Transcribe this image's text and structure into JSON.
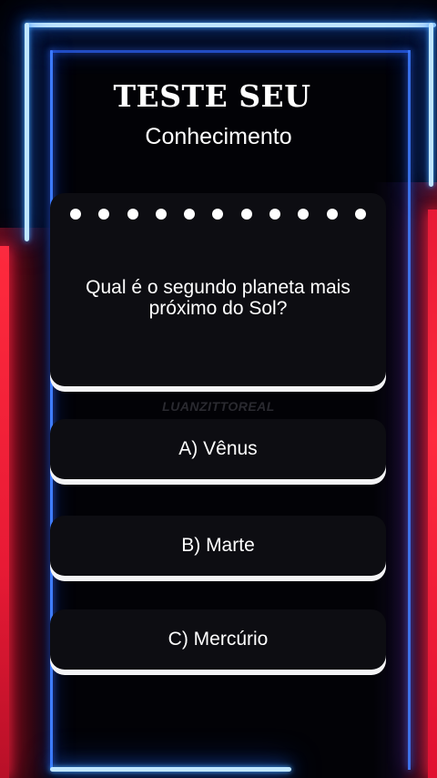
{
  "header": {
    "title": "TESTE SEU",
    "subtitle": "Conhecimento"
  },
  "question": {
    "progress_total": 11,
    "text": "Qual é o segundo planeta mais próximo do Sol?"
  },
  "watermark": "LUANZITTOREAL",
  "options": [
    {
      "label": "A) Vênus"
    },
    {
      "label": "B) Marte"
    },
    {
      "label": "C) Mercúrio"
    }
  ],
  "colors": {
    "neon_blue": "#3f7dff",
    "neon_red": "#ff2a3d",
    "card_bg": "#0d0d12",
    "card_base": "#f4f4f6"
  }
}
